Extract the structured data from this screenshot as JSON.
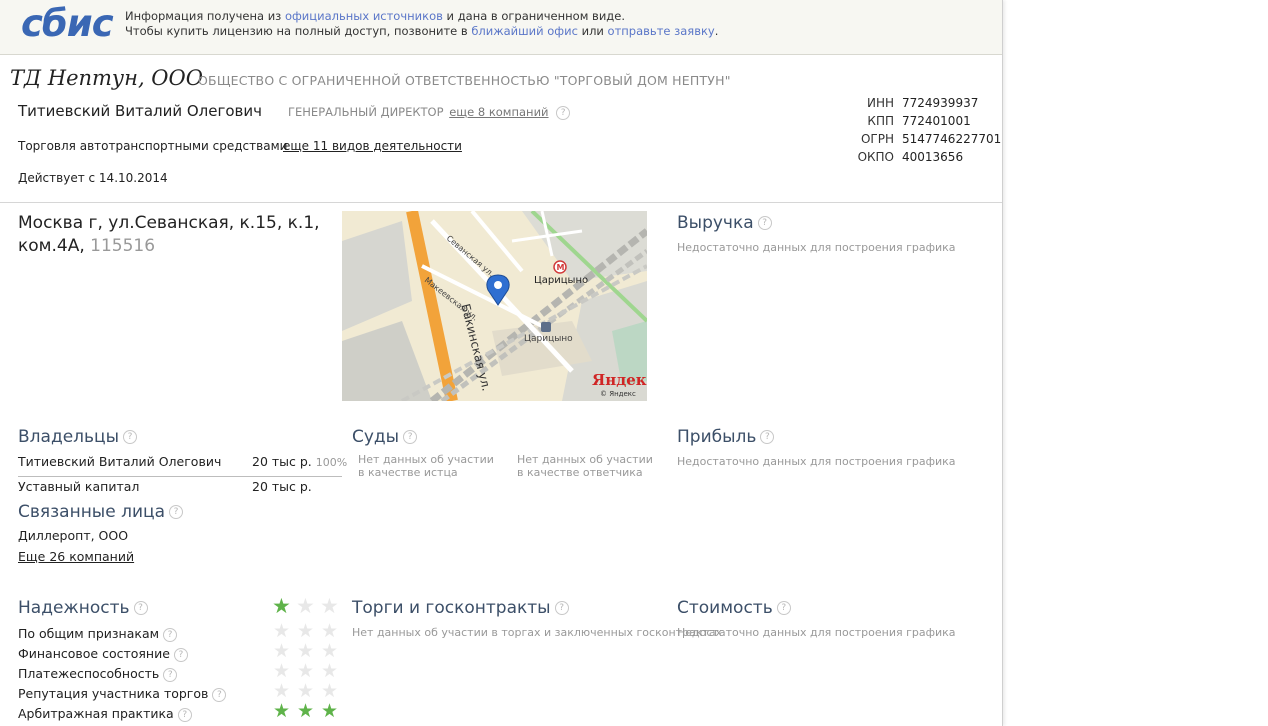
{
  "header": {
    "logo": "сбис",
    "notice_line1_prefix": "Информация получена из ",
    "notice_line1_link": "официальных источников",
    "notice_line1_suffix": " и дана в ограниченном виде.",
    "notice_line2_prefix": "Чтобы купить лицензию на полный доступ, позвоните в ",
    "notice_line2_link1": "ближайший офис",
    "notice_line2_mid": " или ",
    "notice_line2_link2": "отправьте заявку",
    "notice_line2_suffix": "."
  },
  "company": {
    "short_name": "ТД Нептун, ООО",
    "full_name": "ОБЩЕСТВО С ОГРАНИЧЕННОЙ ОТВЕТСТВЕННОСТЬЮ \"ТОРГОВЫЙ ДОМ НЕПТУН\"",
    "director_name": "Титиевский Виталий Олегович",
    "director_role": "ГЕНЕРАЛЬНЫЙ ДИРЕКТОР",
    "director_more": "еще 8 компаний",
    "activity": "Торговля автотранспортными средствами",
    "activity_more": "еще 11 видов деятельности",
    "active_since": "Действует с 14.10.2014",
    "codes": [
      {
        "k": "ИНН",
        "v": "7724939937"
      },
      {
        "k": "КПП",
        "v": "772401001"
      },
      {
        "k": "ОГРН",
        "v": "5147746227701"
      },
      {
        "k": "ОКПО",
        "v": "40013656"
      }
    ],
    "address_line1": "Москва г, ул.Севанская, к.15, к.1,",
    "address_line2": "ком.4А,",
    "zip": "115516"
  },
  "map": {
    "street1": "Бакинская ул.",
    "street2": "Севанская ул.",
    "street3": "Макеевская ул.",
    "metro": "Царицыно",
    "station": "Царицыно",
    "brand": "Яндекс",
    "copyright": "© Яндекс",
    "metro_icon": "M",
    "station_icon": "train-icon",
    "pin_icon": "map-pin-icon"
  },
  "sections": {
    "revenue_title": "Выручка",
    "revenue_nodata": "Недостаточно данных для построения графика",
    "owners_title": "Владельцы",
    "owner_name": "Титиевский Виталий Олегович",
    "owner_amount": "20 тыс р.",
    "owner_pct": "100%",
    "capital_label": "Уставный капитал",
    "capital_amount": "20 тыс р.",
    "courts_title": "Суды",
    "courts_plaintiff": "Нет данных об участии в качестве истца",
    "courts_defendant": "Нет данных об участии в качестве ответчика",
    "profit_title": "Прибыль",
    "profit_nodata": "Недостаточно данных для построения графика",
    "related_title": "Связанные лица",
    "related_item": "Диллеропт, ООО",
    "related_more": "Еще 26 компаний",
    "reliability_title": "Надежность",
    "reliability_rating": 1,
    "reliability_items": [
      {
        "label": "По общим признакам",
        "rating": 0
      },
      {
        "label": "Финансовое состояние",
        "rating": 0
      },
      {
        "label": "Платежеспособность",
        "rating": 0
      },
      {
        "label": "Репутация участника торгов",
        "rating": 0
      },
      {
        "label": "Арбитражная практика",
        "rating": 3
      }
    ],
    "tenders_title": "Торги и госконтракты",
    "tenders_nodata": "Нет данных об участии в торгах и заключенных госконтрактах",
    "value_title": "Стоимость",
    "value_nodata": "Недостаточно данных для построения графика",
    "help_glyph": "?"
  },
  "colors": {
    "accent": "#3a67b4",
    "star_on": "#5fb34a",
    "star_off": "#e8e8e8",
    "section_title": "#3c4f68"
  }
}
